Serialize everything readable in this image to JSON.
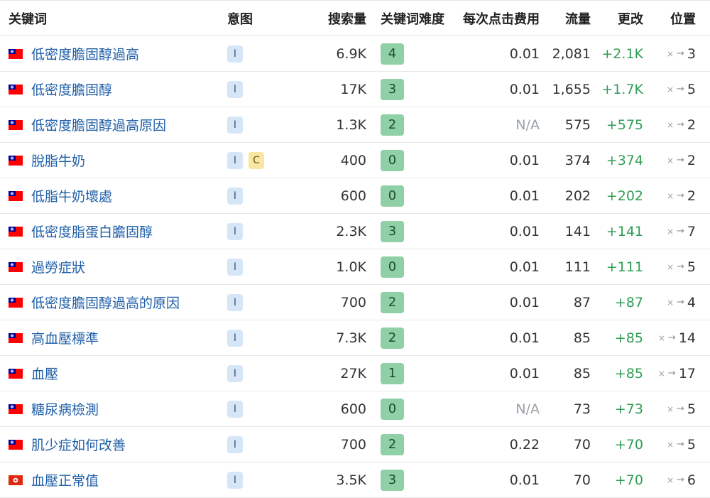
{
  "headers": {
    "keyword": "关键词",
    "intent": "意图",
    "volume": "搜索量",
    "kd": "关键词难度",
    "cpc": "每次点击费用",
    "traffic": "流量",
    "change": "更改",
    "position": "位置"
  },
  "colors": {
    "link": "#1f5fa8",
    "change_positive": "#2f9e55",
    "kd_badge": "#8fd0a6",
    "intent_i": "#d6e6f7",
    "intent_c": "#f7e7a3"
  },
  "rows": [
    {
      "flag": "taiwan-flag-icon",
      "keyword": "低密度膽固醇過高",
      "intent": [
        "I"
      ],
      "volume": "6.9K",
      "kd": "4",
      "cpc": "0.01",
      "traffic": "2,081",
      "change": "+2.1K",
      "position_prev": "×",
      "position_arrow": "→",
      "position": "3"
    },
    {
      "flag": "taiwan-flag-icon",
      "keyword": "低密度膽固醇",
      "intent": [
        "I"
      ],
      "volume": "17K",
      "kd": "3",
      "cpc": "0.01",
      "traffic": "1,655",
      "change": "+1.7K",
      "position_prev": "×",
      "position_arrow": "→",
      "position": "5"
    },
    {
      "flag": "taiwan-flag-icon",
      "keyword": "低密度膽固醇過高原因",
      "intent": [
        "I"
      ],
      "volume": "1.3K",
      "kd": "2",
      "cpc": "N/A",
      "traffic": "575",
      "change": "+575",
      "position_prev": "×",
      "position_arrow": "→",
      "position": "2"
    },
    {
      "flag": "taiwan-flag-icon",
      "keyword": "脫脂牛奶",
      "intent": [
        "I",
        "C"
      ],
      "volume": "400",
      "kd": "0",
      "cpc": "0.01",
      "traffic": "374",
      "change": "+374",
      "position_prev": "×",
      "position_arrow": "→",
      "position": "2"
    },
    {
      "flag": "taiwan-flag-icon",
      "keyword": "低脂牛奶壞處",
      "intent": [
        "I"
      ],
      "volume": "600",
      "kd": "0",
      "cpc": "0.01",
      "traffic": "202",
      "change": "+202",
      "position_prev": "×",
      "position_arrow": "→",
      "position": "2"
    },
    {
      "flag": "taiwan-flag-icon",
      "keyword": "低密度脂蛋白膽固醇",
      "intent": [
        "I"
      ],
      "volume": "2.3K",
      "kd": "3",
      "cpc": "0.01",
      "traffic": "141",
      "change": "+141",
      "position_prev": "×",
      "position_arrow": "→",
      "position": "7"
    },
    {
      "flag": "taiwan-flag-icon",
      "keyword": "過勞症狀",
      "intent": [
        "I"
      ],
      "volume": "1.0K",
      "kd": "0",
      "cpc": "0.01",
      "traffic": "111",
      "change": "+111",
      "position_prev": "×",
      "position_arrow": "→",
      "position": "5"
    },
    {
      "flag": "taiwan-flag-icon",
      "keyword": "低密度膽固醇過高的原因",
      "intent": [
        "I"
      ],
      "volume": "700",
      "kd": "2",
      "cpc": "0.01",
      "traffic": "87",
      "change": "+87",
      "position_prev": "×",
      "position_arrow": "→",
      "position": "4"
    },
    {
      "flag": "taiwan-flag-icon",
      "keyword": "高血壓標準",
      "intent": [
        "I"
      ],
      "volume": "7.3K",
      "kd": "2",
      "cpc": "0.01",
      "traffic": "85",
      "change": "+85",
      "position_prev": "×",
      "position_arrow": "→",
      "position": "14"
    },
    {
      "flag": "taiwan-flag-icon",
      "keyword": "血壓",
      "intent": [
        "I"
      ],
      "volume": "27K",
      "kd": "1",
      "cpc": "0.01",
      "traffic": "85",
      "change": "+85",
      "position_prev": "×",
      "position_arrow": "→",
      "position": "17"
    },
    {
      "flag": "taiwan-flag-icon",
      "keyword": "糖尿病檢測",
      "intent": [
        "I"
      ],
      "volume": "600",
      "kd": "0",
      "cpc": "N/A",
      "traffic": "73",
      "change": "+73",
      "position_prev": "×",
      "position_arrow": "→",
      "position": "5"
    },
    {
      "flag": "taiwan-flag-icon",
      "keyword": "肌少症如何改善",
      "intent": [
        "I"
      ],
      "volume": "700",
      "kd": "2",
      "cpc": "0.22",
      "traffic": "70",
      "change": "+70",
      "position_prev": "×",
      "position_arrow": "→",
      "position": "5"
    },
    {
      "flag": "hong-kong-flag-icon",
      "keyword": "血壓正常值",
      "intent": [
        "I"
      ],
      "volume": "3.5K",
      "kd": "3",
      "cpc": "0.01",
      "traffic": "70",
      "change": "+70",
      "position_prev": "×",
      "position_arrow": "→",
      "position": "6"
    }
  ]
}
